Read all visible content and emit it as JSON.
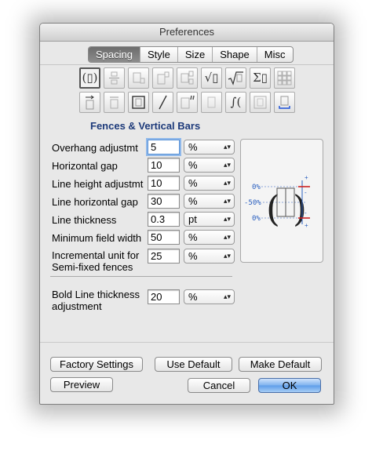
{
  "window": {
    "title": "Preferences"
  },
  "tabs": [
    {
      "label": "Spacing",
      "active": true
    },
    {
      "label": "Style",
      "active": false
    },
    {
      "label": "Size",
      "active": false
    },
    {
      "label": "Shape",
      "active": false
    },
    {
      "label": "Misc",
      "active": false
    }
  ],
  "palette": {
    "row1": [
      "(▯)",
      "fraction",
      "subscript",
      "superscript",
      "sub-super",
      "√▯",
      "nth-root",
      "Σ▯",
      "matrix"
    ],
    "row2": [
      "arrow",
      "overbar",
      "boxed",
      "slash",
      "prime",
      "blank",
      "integral",
      "bracketed",
      "underbrace"
    ]
  },
  "section": {
    "title": "Fences & Vertical Bars"
  },
  "fields": [
    {
      "label": "Overhang adjustmt",
      "value": "5",
      "unit": "%"
    },
    {
      "label": "Horizontal gap",
      "value": "10",
      "unit": "%"
    },
    {
      "label": "Line height adjustmt",
      "value": "10",
      "unit": "%"
    },
    {
      "label": "Line horizontal gap",
      "value": "30",
      "unit": "%"
    },
    {
      "label": "Line thickness",
      "value": "0.3",
      "unit": "pt"
    },
    {
      "label": "Minimum field width",
      "value": "50",
      "unit": "%"
    },
    {
      "label_line1": "Incremental unit for",
      "label_line2": "Semi-fixed fences",
      "value": "25",
      "unit": "%"
    }
  ],
  "bold_line": {
    "label_line1": "Bold Line thickness",
    "label_line2": "adjustment",
    "value": "20",
    "unit": "%"
  },
  "preview": {
    "top_label": "0%",
    "mid_label": "-50%",
    "bottom_label": "0%",
    "plus": "+",
    "minus": "-"
  },
  "buttons": {
    "factory": "Factory Settings",
    "use_default": "Use Default",
    "make_default": "Make Default",
    "preview": "Preview",
    "cancel": "Cancel",
    "ok": "OK"
  },
  "colors": {
    "section_title": "#1d3a7a",
    "preview_blue": "#2a5fbf",
    "preview_red": "#cc2222",
    "default_button": "#5d9de9"
  }
}
